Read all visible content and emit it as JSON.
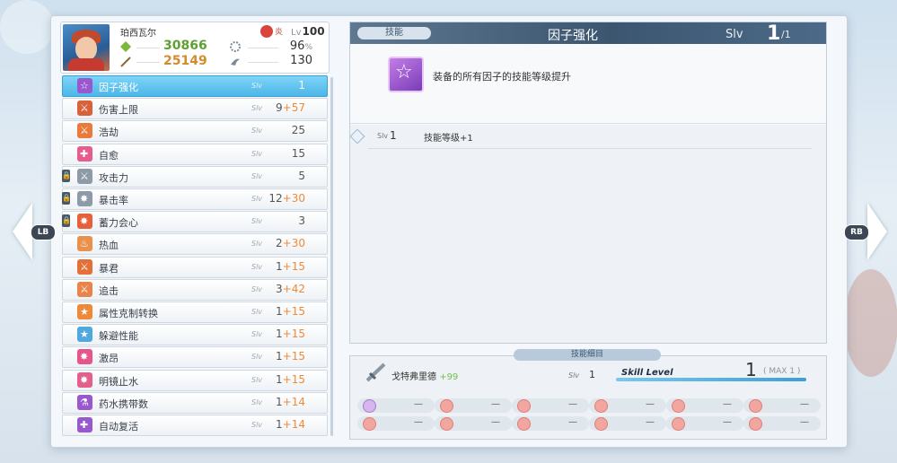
{
  "character": {
    "name": "珀西瓦尔",
    "element": "炎",
    "level_label": "Lv",
    "level": "100",
    "hp": "30866",
    "atk": "25149",
    "stat_right_1": "96",
    "stat_right_1_unit": "%",
    "stat_right_2": "130"
  },
  "nav": {
    "left_button": "LB",
    "right_button": "RB"
  },
  "skills": [
    {
      "name": "因子强化",
      "slv": "Slv",
      "level": "1",
      "bonus": "",
      "locked": false,
      "color": "#9a58cf",
      "glyph": "☆"
    },
    {
      "name": "伤害上限",
      "slv": "Slv",
      "level": "9",
      "bonus": "+57",
      "locked": false,
      "color": "#d9623a",
      "glyph": "⚔"
    },
    {
      "name": "浩劫",
      "slv": "Slv",
      "level": "25",
      "bonus": "",
      "locked": false,
      "color": "#e87a3c",
      "glyph": "⚔"
    },
    {
      "name": "自愈",
      "slv": "Slv",
      "level": "15",
      "bonus": "",
      "locked": false,
      "color": "#e75c8c",
      "glyph": "✚"
    },
    {
      "name": "攻击力",
      "slv": "Slv",
      "level": "5",
      "bonus": "",
      "locked": true,
      "color": "#8d9aa7",
      "glyph": "⚔"
    },
    {
      "name": "暴击率",
      "slv": "Slv",
      "level": "12",
      "bonus": "+30",
      "locked": true,
      "color": "#8d9aa7",
      "glyph": "✸"
    },
    {
      "name": "蓄力会心",
      "slv": "Slv",
      "level": "3",
      "bonus": "",
      "locked": true,
      "color": "#e6603a",
      "glyph": "✸"
    },
    {
      "name": "热血",
      "slv": "Slv",
      "level": "2",
      "bonus": "+30",
      "locked": false,
      "color": "#e9914c",
      "glyph": "♨"
    },
    {
      "name": "暴君",
      "slv": "Slv",
      "level": "1",
      "bonus": "+15",
      "locked": false,
      "color": "#e27038",
      "glyph": "⚔"
    },
    {
      "name": "追击",
      "slv": "Slv",
      "level": "3",
      "bonus": "+42",
      "locked": false,
      "color": "#e9844a",
      "glyph": "⚔"
    },
    {
      "name": "属性克制转换",
      "slv": "Slv",
      "level": "1",
      "bonus": "+15",
      "locked": false,
      "color": "#ec8a3a",
      "glyph": "★"
    },
    {
      "name": "躲避性能",
      "slv": "Slv",
      "level": "1",
      "bonus": "+15",
      "locked": false,
      "color": "#4fa9df",
      "glyph": "★"
    },
    {
      "name": "激昂",
      "slv": "Slv",
      "level": "1",
      "bonus": "+15",
      "locked": false,
      "color": "#e6568a",
      "glyph": "✸"
    },
    {
      "name": "明镜止水",
      "slv": "Slv",
      "level": "1",
      "bonus": "+15",
      "locked": false,
      "color": "#e35f8c",
      "glyph": "✸"
    },
    {
      "name": "药水携带数",
      "slv": "Slv",
      "level": "1",
      "bonus": "+14",
      "locked": false,
      "color": "#9a58cf",
      "glyph": "⚗"
    },
    {
      "name": "自动复活",
      "slv": "Slv",
      "level": "1",
      "bonus": "+14",
      "locked": false,
      "color": "#9a58cf",
      "glyph": "✚"
    }
  ],
  "detail": {
    "tab": "技能",
    "title": "因子强化",
    "slv_label": "Slv",
    "slv_current": "1",
    "slv_max": "/1",
    "description": "装备的所有因子的技能等级提升",
    "level_rows": [
      {
        "slv_label": "Slv",
        "level": "1",
        "effect": "技能等级+1"
      }
    ]
  },
  "source": {
    "tab": "技能细目",
    "weapon_name": "戈特弗里德",
    "weapon_bonus": "+99",
    "slv_label": "Slv",
    "slv": "1",
    "skill_level_label": "Skill Level",
    "skill_level": "1",
    "max_label": "( MAX 1 )",
    "slots": [
      [
        "—",
        "—",
        "—",
        "—",
        "—",
        "—"
      ],
      [
        "—",
        "—",
        "—",
        "—",
        "—",
        "—"
      ]
    ]
  }
}
